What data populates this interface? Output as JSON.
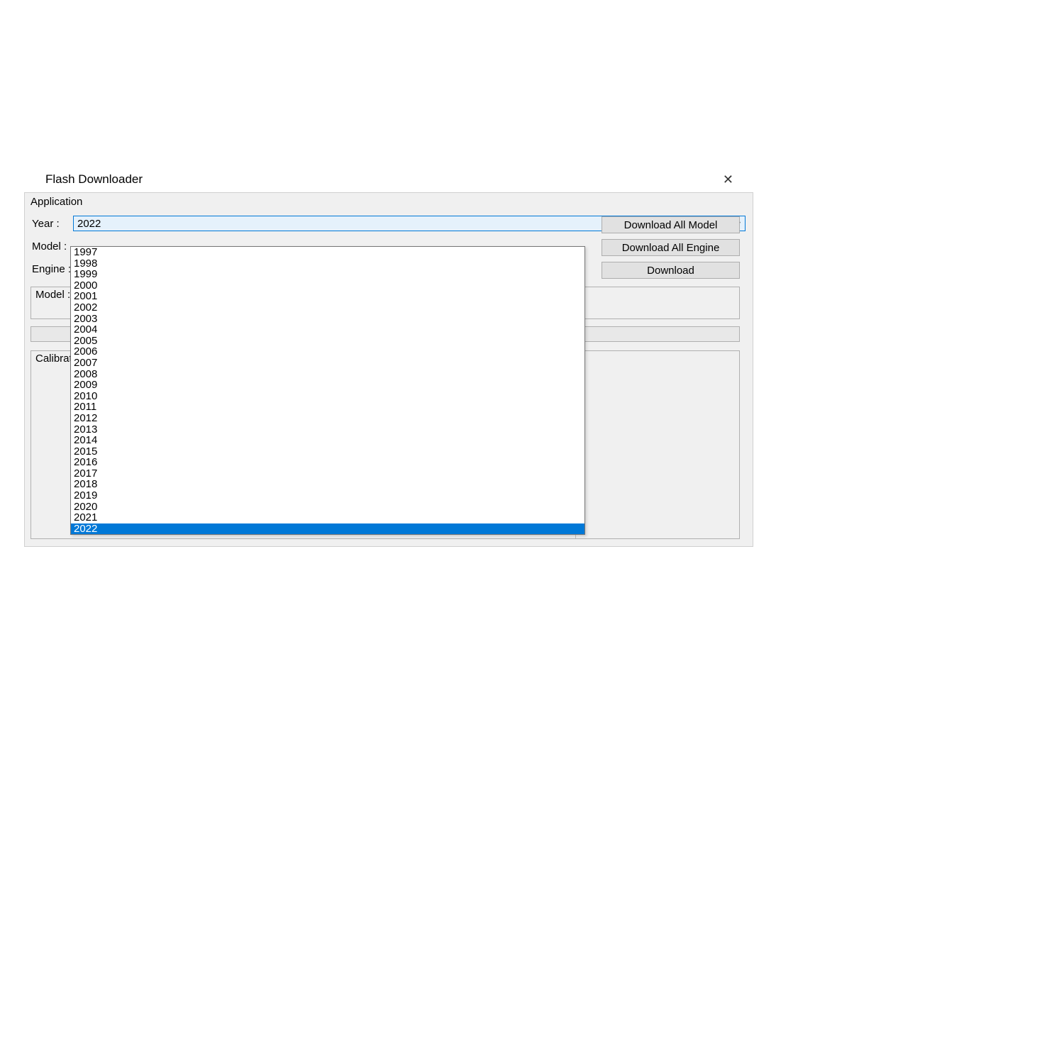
{
  "window": {
    "title": "Flash Downloader"
  },
  "menu": {
    "application": "Application"
  },
  "labels": {
    "year": "Year :",
    "model": "Model :",
    "engine": "Engine :",
    "model_info": "Model : L",
    "calibration": "Calibration"
  },
  "combo": {
    "year_selected": "2022"
  },
  "buttons": {
    "download_all_model": "Download All Model",
    "download_all_engine": "Download All Engine",
    "download": "Download"
  },
  "year_options": [
    "1997",
    "1998",
    "1999",
    "2000",
    "2001",
    "2002",
    "2003",
    "2004",
    "2005",
    "2006",
    "2007",
    "2008",
    "2009",
    "2010",
    "2011",
    "2012",
    "2013",
    "2014",
    "2015",
    "2016",
    "2017",
    "2018",
    "2019",
    "2020",
    "2021",
    "2022"
  ],
  "year_selected_index": 25
}
